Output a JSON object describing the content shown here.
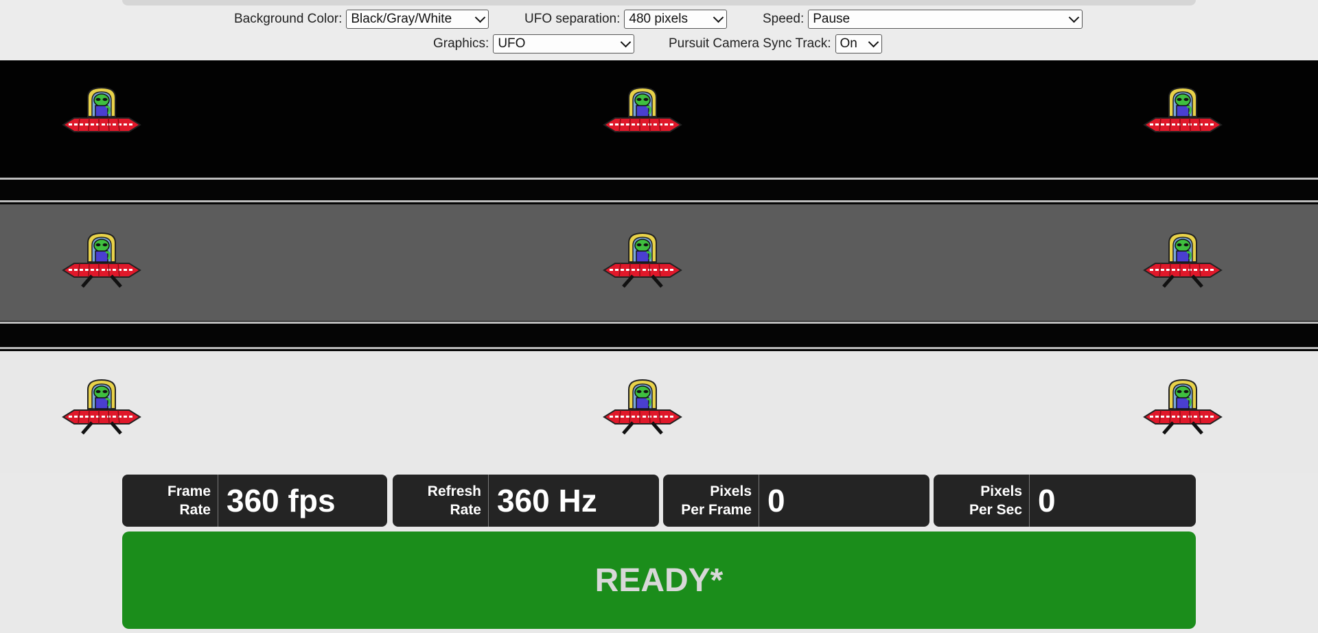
{
  "controls": {
    "background_color": {
      "label": "Background Color:",
      "value": "Black/Gray/White"
    },
    "ufo_separation": {
      "label": "UFO separation:",
      "value": "480 pixels"
    },
    "speed": {
      "label": "Speed:",
      "value": "Pause"
    },
    "graphics": {
      "label": "Graphics:",
      "value": "UFO"
    },
    "pursuit_camera": {
      "label": "Pursuit Camera Sync Track:",
      "value": "On"
    }
  },
  "lanes": [
    {
      "name": "black",
      "color": "#020202",
      "legs": false
    },
    {
      "name": "gray",
      "color": "#5c5c5c",
      "legs": true
    },
    {
      "name": "white",
      "color": "#e8e8e8",
      "legs": true
    }
  ],
  "stats": [
    {
      "label1": "Frame",
      "label2": "Rate",
      "value": "360 fps"
    },
    {
      "label1": "Refresh",
      "label2": "Rate",
      "value": "360 Hz"
    },
    {
      "label1": "Pixels",
      "label2": "Per Frame",
      "value": "0"
    },
    {
      "label1": "Pixels",
      "label2": "Per Sec",
      "value": "0"
    }
  ],
  "status": {
    "text": "READY*",
    "color": "#1b8d1b"
  },
  "icons": {
    "ufo": "ufo-alien-icon",
    "dropdown": "chevron-down-icon"
  }
}
